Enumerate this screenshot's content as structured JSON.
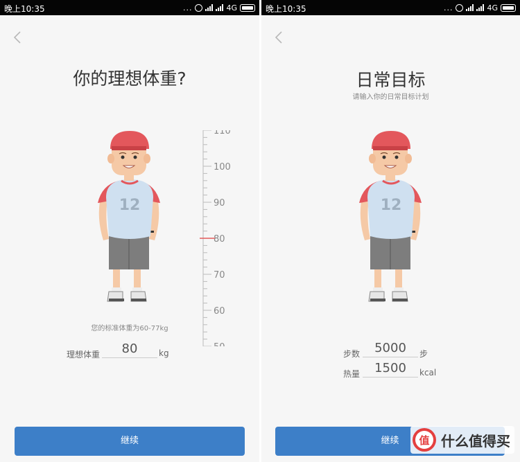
{
  "status_bar": {
    "time": "晚上10:35",
    "dots": "...",
    "network": "4G"
  },
  "screen1": {
    "title": "你的理想体重?",
    "ruler_ticks": [
      "110",
      "100",
      "90",
      "80",
      "70",
      "60",
      "50"
    ],
    "ruler_selected": 80,
    "hint": "您的标准体重为60-77kg",
    "ideal_weight": {
      "label": "理想体重",
      "value": "80",
      "unit": "kg"
    },
    "continue_label": "继续"
  },
  "screen2": {
    "title": "日常目标",
    "subtitle": "请输入你的日常目标计划",
    "steps": {
      "label": "步数",
      "value": "5000",
      "unit": "步"
    },
    "calories": {
      "label": "热量",
      "value": "1500",
      "unit": "kcal"
    },
    "continue_label": "继续"
  },
  "avatar": {
    "jersey_number": "12"
  },
  "watermark": {
    "text": "什么值得买",
    "logo_glyph": "值"
  },
  "colors": {
    "primary": "#3d7fc8",
    "cap": "#e3575c",
    "ruler_indicator": "#e35a5a"
  }
}
